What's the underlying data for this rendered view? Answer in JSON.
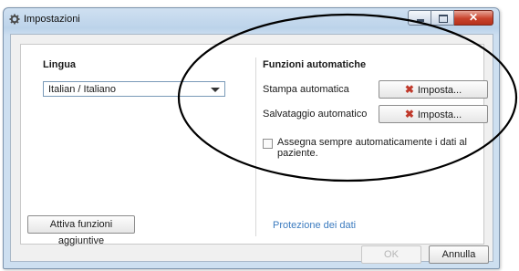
{
  "window": {
    "title": "Impostazioni",
    "icon": "gear-icon",
    "controls": {
      "minimize": "minimize-icon",
      "maximize": "maximize-icon",
      "close": "✕"
    }
  },
  "language": {
    "title": "Lingua",
    "selected": "Italian / Italiano"
  },
  "auto_functions": {
    "title": "Funzioni automatiche",
    "rows": [
      {
        "label": "Stampa automatica",
        "button": "Imposta..."
      },
      {
        "label": "Salvataggio automatico",
        "button": "Imposta..."
      }
    ],
    "checkbox_label": "Assegna sempre automaticamente i dati al paziente.",
    "checkbox_checked": false
  },
  "footer": {
    "extra_button": "Attiva funzioni aggiuntive",
    "privacy_link": "Protezione dei dati",
    "ok": "OK",
    "cancel": "Annulla"
  },
  "colors": {
    "link": "#3b7bbf",
    "close_button": "#c9432c",
    "title_bar": "#bcd3ea",
    "x_mark": "#c0392b"
  }
}
